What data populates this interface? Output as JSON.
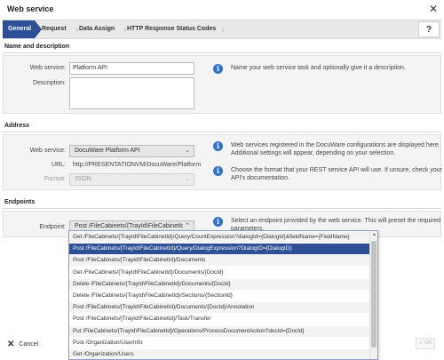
{
  "window": {
    "title": "Web service",
    "close_icon": "✕"
  },
  "wizard": {
    "steps": [
      "General",
      "Request",
      "Data Assign",
      "HTTP Response Status Codes"
    ],
    "help_label": "?"
  },
  "sections": {
    "name": {
      "header": "Name and description",
      "webservice_label": "Web service:",
      "webservice_value": "Platform API",
      "description_label": "Description:",
      "info": "Name your web service task and optionally give it a description."
    },
    "address": {
      "header": "Address",
      "webservice_label": "Web service:",
      "webservice_value": "DocuWare Platform API",
      "url_label": "URL:",
      "url_value": "http://PRESENTATIONVM/DocuWare/Platform",
      "format_label": "Format:",
      "format_value": "JSON",
      "info1": "Web services registered in the DocuWare configurations are displayed here. Additional settings will appear, depending on your selection.",
      "info2": "Choose the format that your REST service API will use. If unsure, check your API's documentation."
    },
    "endpoints": {
      "header": "Endpoints",
      "endpoint_label": "Endpoint:",
      "endpoint_value": "Post  /FileCabinets/{TrayId\\FileCabinetId",
      "info": "Select an endpoint provided by the web service. This will preset the required parameters."
    }
  },
  "dropdown": {
    "selected_index": 1,
    "items": [
      "Get   /FileCabinets/{TrayId\\FileCabinetId}/Query/CountExpression?dialogId={DialogId}&fieldName={FieldName}",
      "Post   /FileCabinets/{TrayId\\FileCabinetId}/Query/DialogExpression?DialogID={DialogID}",
      "Post   /FileCabinets/{TrayId\\FileCabinetId}/Documents",
      "Get   /FileCabinets/{TrayId\\FileCabinetId}/Documents/{DocId}",
      "Delete   /FileCabinets/{TrayId\\FileCabinetId}/Documents/{DocId}",
      "Delete   /FileCabinets/{TrayId\\FileCabinetId}/Sections/{SectionId}",
      "Post   /FileCabinets/{TrayId\\FileCabinetId}/Documents/{DocId}/Annotation",
      "Post   /FileCabinets/{TrayId\\FileCabinetId}/Task/Transfer",
      "Put   /FileCabinets/{TrayId\\FileCabinetId}/Operations/ProcessDocumentAction?docId={DocId}",
      "Post   /Organization/UserInfo",
      "Get   /Organization/Users"
    ]
  },
  "footer": {
    "cancel_label": "Cancel",
    "ok_label": "✓ OK"
  },
  "colors": {
    "accent": "#2d4f96",
    "info": "#2f72c8"
  }
}
